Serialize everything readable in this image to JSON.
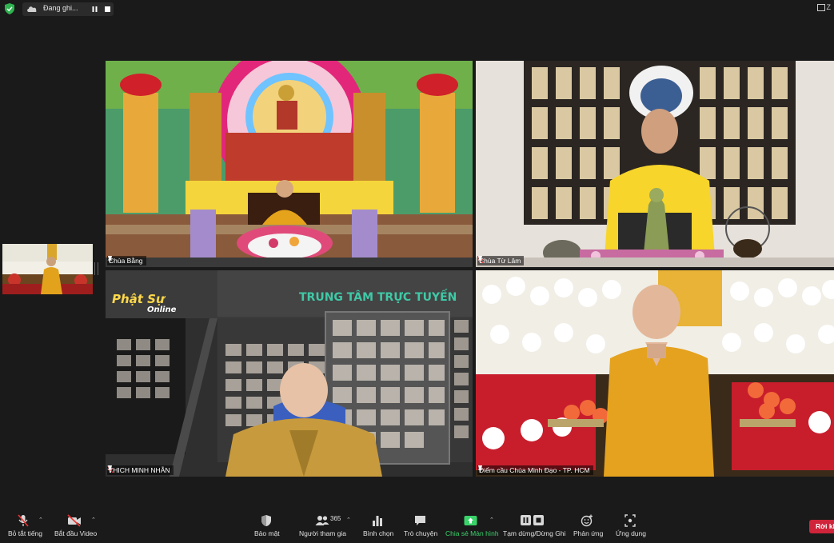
{
  "topbar": {
    "recording_label": "Đang ghi...",
    "corner_text": "Z"
  },
  "tiles": [
    {
      "name": "Chùa Bằng"
    },
    {
      "name": "Chùa Từ Lâm"
    },
    {
      "name": "THICH MINH NHẪN",
      "banner_logo_1": "Phật Sự",
      "banner_logo_2": "Online",
      "banner_title": "TRUNG TÂM TRỰC TUYẾN"
    },
    {
      "name": "Điểm cầu Chùa Minh Đạo - TP. HCM"
    }
  ],
  "toolbar": {
    "mute_label": "Bỏ tắt tiếng",
    "video_label": "Bắt đầu Video",
    "security_label": "Bảo mật",
    "participants_label": "Người tham gia",
    "participants_count": "365",
    "poll_label": "Bình chọn",
    "chat_label": "Trò chuyện",
    "share_label": "Chia sẻ Màn hình",
    "record_label": "Tạm dừng/Dừng Ghi",
    "reactions_label": "Phản ứng",
    "apps_label": "Ứng dụng",
    "leave_label": "Rời khỏi"
  },
  "colors": {
    "accent_green": "#3ad36b",
    "leave_red": "#d0243a",
    "background": "#1a1a1a"
  },
  "icons": [
    "shield-icon",
    "cloud-icon",
    "pause-icon",
    "stop-icon",
    "mic-muted-icon",
    "video-off-icon",
    "security-icon",
    "participants-icon",
    "poll-icon",
    "chat-icon",
    "share-screen-icon",
    "record-control-icon",
    "reaction-icon",
    "apps-icon",
    "pin-icon"
  ]
}
